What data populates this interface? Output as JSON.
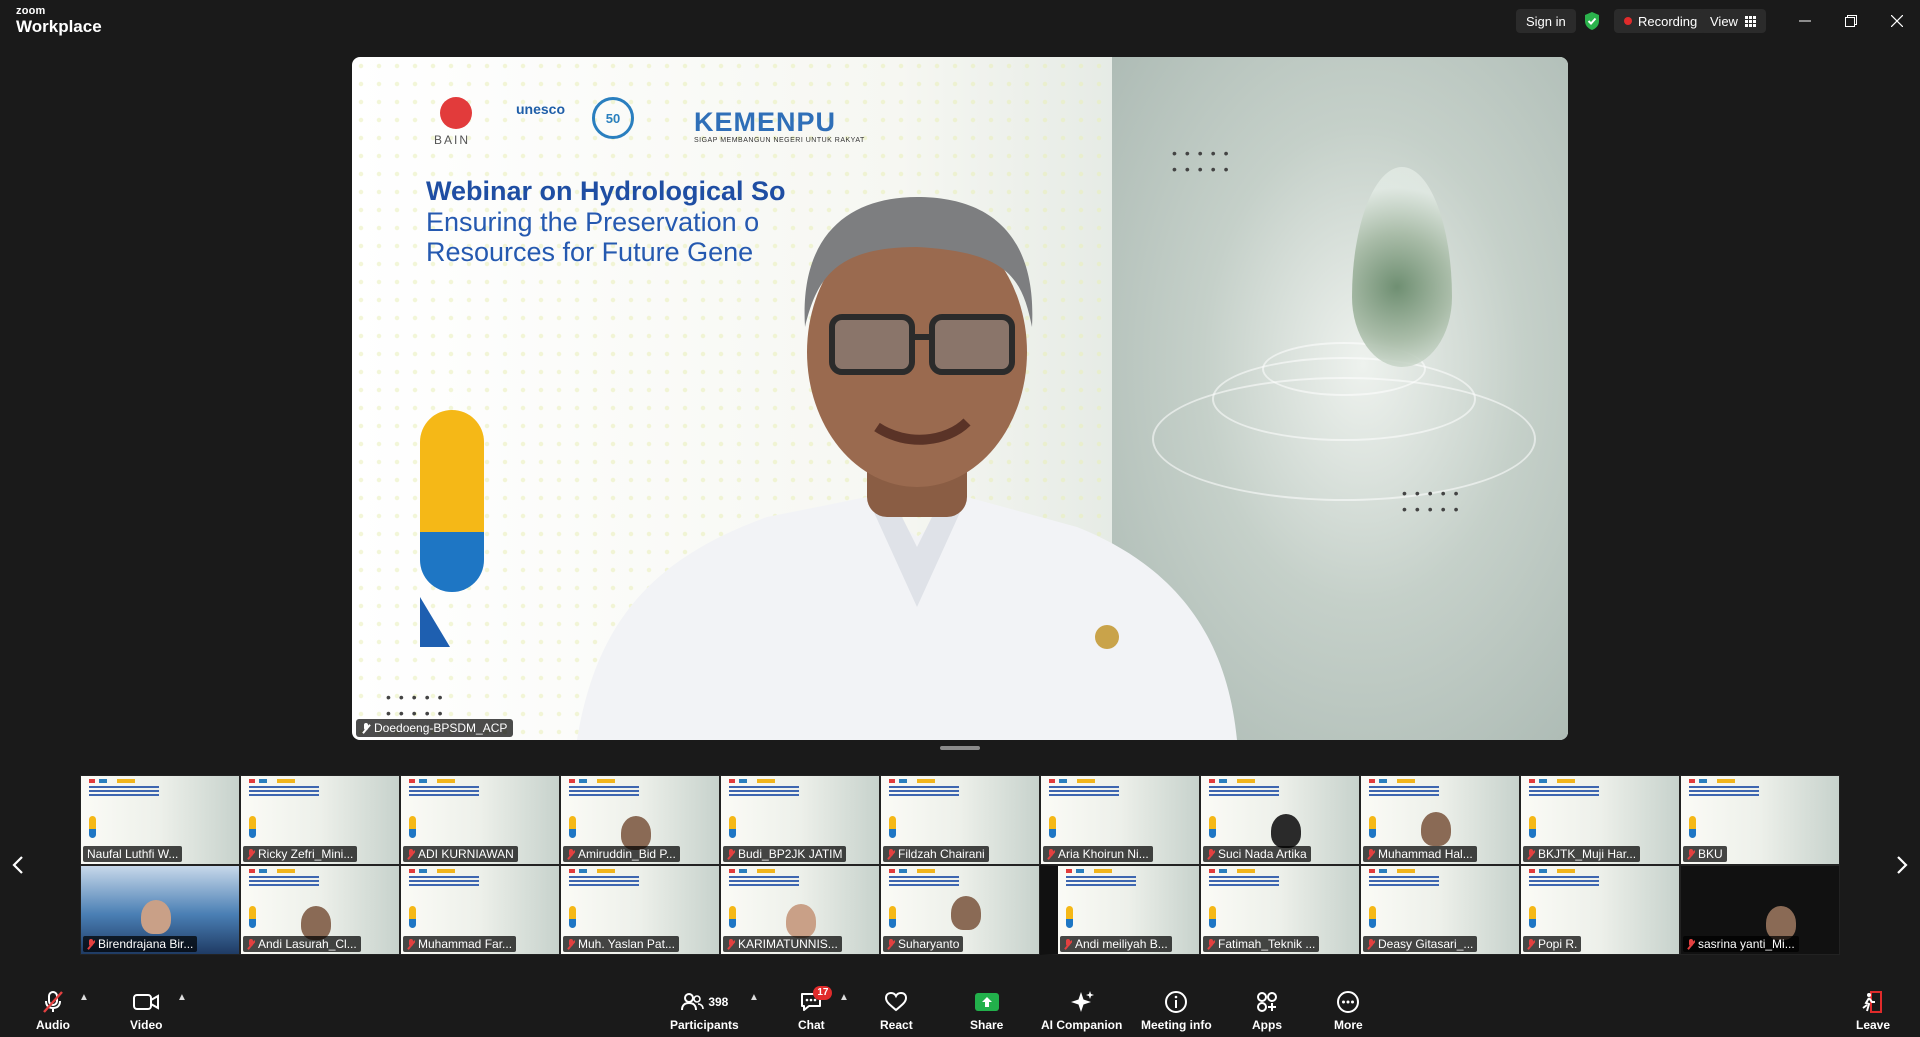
{
  "app": {
    "brand_small": "zoom",
    "brand_big": "Workplace"
  },
  "topbar": {
    "sign_in": "Sign in",
    "recording": "Recording",
    "view": "View"
  },
  "slide": {
    "bain_label": "BAIN",
    "unesco_label": "unesco",
    "fifty_label": "50",
    "kemenpu_label": "KEMENPU",
    "kemenpu_tagline": "SIGAP MEMBANGUN NEGERI UNTUK RAKYAT",
    "title": "Webinar on Hydrological So",
    "subtitle_line1": "Ensuring the Preservation o",
    "subtitle_line2": "Resources for Future Gene"
  },
  "speaker": {
    "name": "Doedoeng-BPSDM_ACP"
  },
  "gallery": {
    "row1": [
      {
        "name": "Naufal Luthfi W...",
        "muted": false
      },
      {
        "name": "Ricky Zefri_Mini...",
        "muted": true
      },
      {
        "name": "ADI KURNIAWAN",
        "muted": true
      },
      {
        "name": "Amiruddin_Bid P...",
        "muted": true
      },
      {
        "name": "Budi_BP2JK JATIM",
        "muted": true
      },
      {
        "name": "Fildzah Chairani",
        "muted": true
      },
      {
        "name": "Aria Khoirun Ni...",
        "muted": true
      },
      {
        "name": "Suci Nada Artika",
        "muted": true
      },
      {
        "name": "Muhammad Hal...",
        "muted": true
      },
      {
        "name": "BKJTK_Muji Har...",
        "muted": true
      },
      {
        "name": "BKU",
        "muted": true
      }
    ],
    "row2": [
      {
        "name": "Birendrajana Bir...",
        "muted": true
      },
      {
        "name": "Andi Lasurah_Cl...",
        "muted": true
      },
      {
        "name": "Muhammad Far...",
        "muted": true
      },
      {
        "name": "Muh. Yaslan Pat...",
        "muted": true
      },
      {
        "name": "KARIMATUNNIS...",
        "muted": true
      },
      {
        "name": "Suharyanto",
        "muted": true
      },
      {
        "name": "Andi meiliyah B...",
        "muted": true
      },
      {
        "name": "Fatimah_Teknik ...",
        "muted": true
      },
      {
        "name": "Deasy Gitasari_...",
        "muted": true
      },
      {
        "name": "Popi R.",
        "muted": true
      },
      {
        "name": "sasrina yanti_Mi...",
        "muted": true
      }
    ]
  },
  "toolbar": {
    "audio": "Audio",
    "video": "Video",
    "participants": "Participants",
    "participants_count": "398",
    "chat": "Chat",
    "chat_badge": "17",
    "react": "React",
    "share": "Share",
    "ai_companion": "AI Companion",
    "meeting_info": "Meeting info",
    "apps": "Apps",
    "more": "More",
    "leave": "Leave"
  },
  "colors": {
    "recording_dot": "#e02b2b",
    "share_green": "#22b04b",
    "leave_red": "#e02b2b",
    "shield_green": "#2bb24c"
  }
}
